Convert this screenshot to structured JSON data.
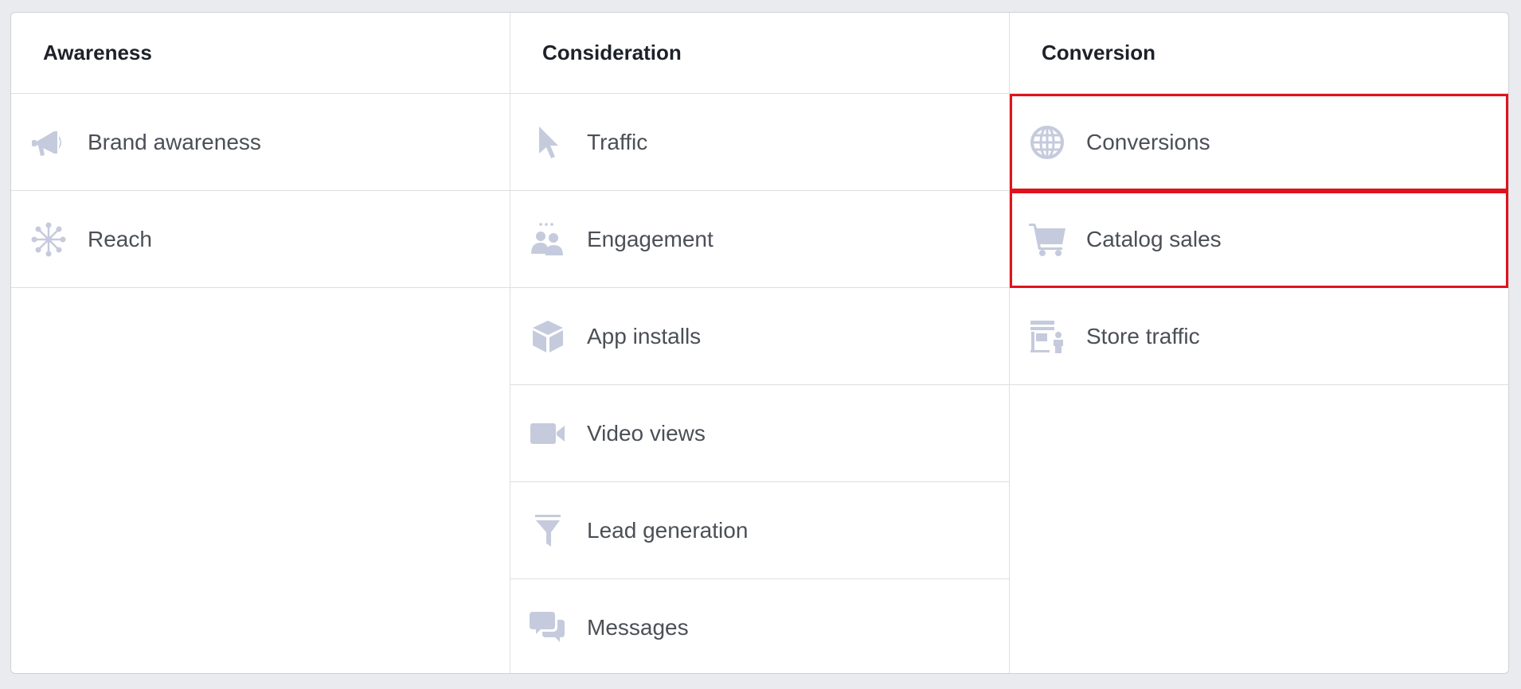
{
  "columns": [
    {
      "title": "Awareness",
      "items": [
        {
          "label": "Brand awareness",
          "icon": "megaphone-icon"
        },
        {
          "label": "Reach",
          "icon": "network-icon"
        }
      ]
    },
    {
      "title": "Consideration",
      "items": [
        {
          "label": "Traffic",
          "icon": "cursor-icon"
        },
        {
          "label": "Engagement",
          "icon": "people-icon"
        },
        {
          "label": "App installs",
          "icon": "box-icon"
        },
        {
          "label": "Video views",
          "icon": "video-camera-icon"
        },
        {
          "label": "Lead generation",
          "icon": "funnel-icon"
        },
        {
          "label": "Messages",
          "icon": "chat-bubbles-icon"
        }
      ]
    },
    {
      "title": "Conversion",
      "items": [
        {
          "label": "Conversions",
          "icon": "globe-icon",
          "highlighted": true
        },
        {
          "label": "Catalog sales",
          "icon": "shopping-cart-icon",
          "highlighted": true
        },
        {
          "label": "Store traffic",
          "icon": "store-person-icon"
        }
      ]
    }
  ],
  "colors": {
    "icon": "#c5cbdd",
    "label": "#4b4f56",
    "header": "#1d2129",
    "highlight_border": "#e0131c",
    "divider": "#dddfe2",
    "background": "#e9ebee"
  }
}
